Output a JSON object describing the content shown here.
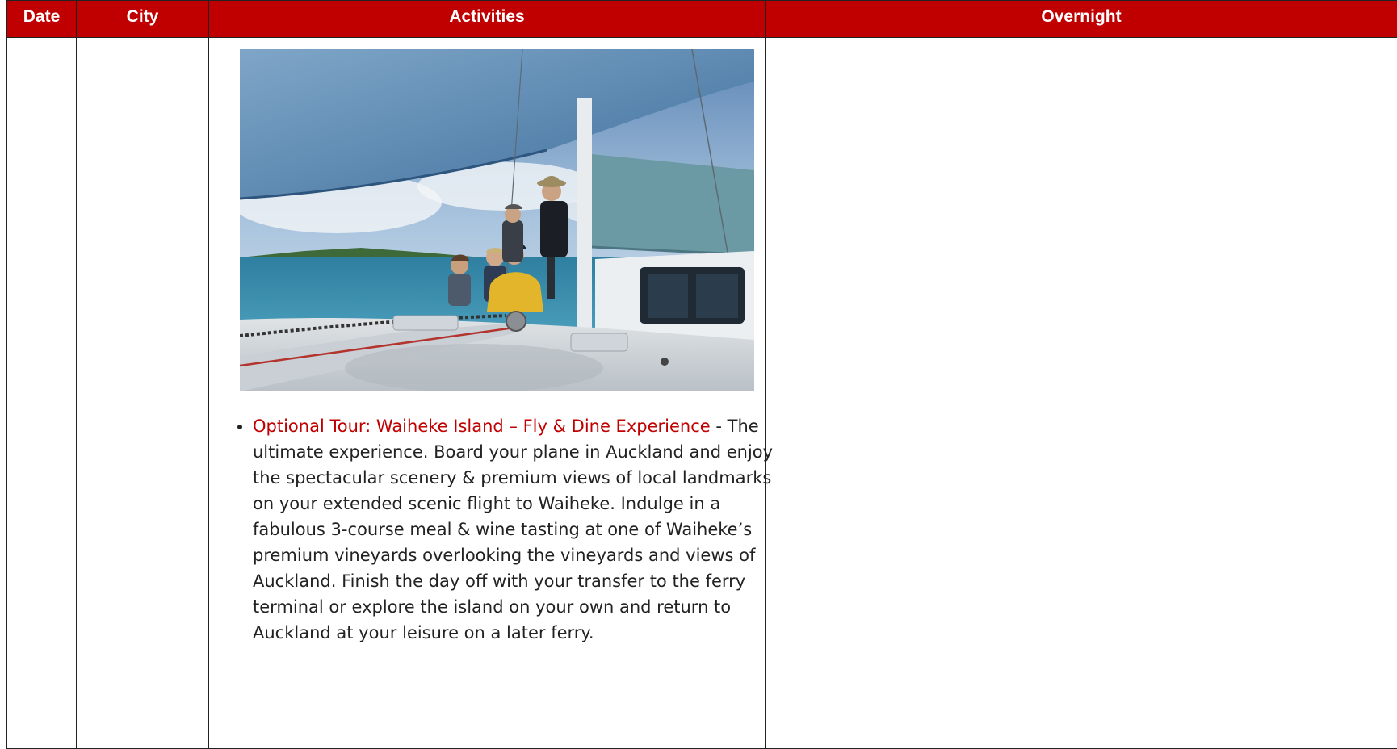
{
  "table": {
    "headers": {
      "date": "Date",
      "city": "City",
      "activities": "Activities",
      "overnight": "Overnight"
    },
    "row": {
      "date": "",
      "city": "",
      "overnight": "",
      "activity": {
        "tour_title": "Optional Tour: Waiheke Island – Fly & Dine Experience",
        "separator": " -",
        "description": "The ultimate experience. Board your plane in Auckland and enjoy the spectacular scenery & premium views of local landmarks on your extended scenic flight to Waiheke. Indulge in a fabulous 3-course meal & wine tasting at one of Waiheke’s premium vineyards overlooking the vineyards and views of Auckland. Finish the day off with your transfer to the ferry terminal or explore the island on your own and return to Auckland at your leisure on a later ferry."
      }
    }
  },
  "colors": {
    "header_bg": "#c00000",
    "header_text": "#ffffff",
    "link": "#c00000"
  }
}
